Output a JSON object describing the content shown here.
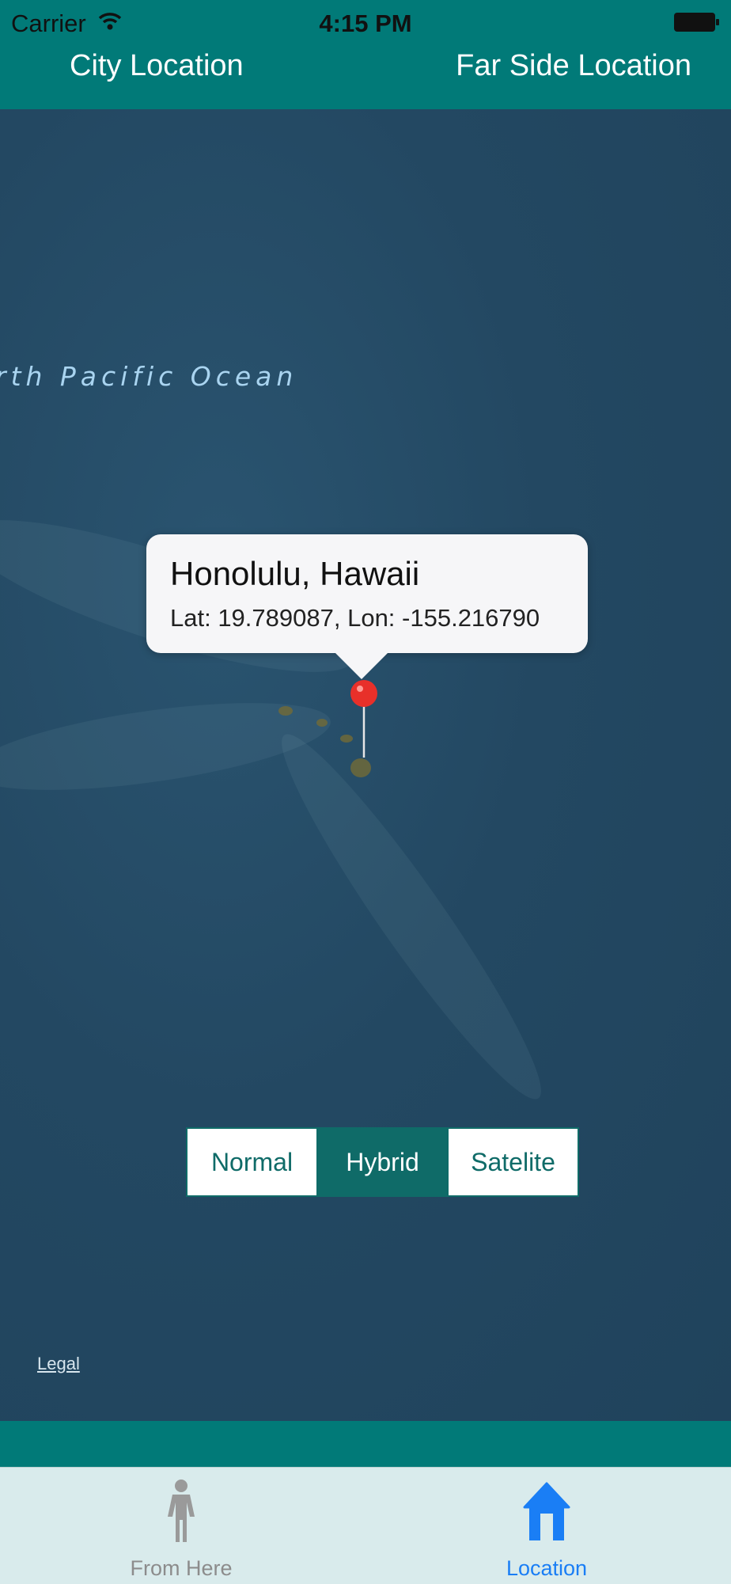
{
  "status_bar": {
    "carrier": "Carrier",
    "time": "4:15 PM"
  },
  "nav": {
    "left_button": "City Location",
    "right_button": "Far Side Location"
  },
  "map": {
    "ocean_label": "rth Pacific Ocean",
    "callout": {
      "title": "Honolulu, Hawaii",
      "subtitle": "Lat: 19.789087, Lon: -155.216790"
    },
    "legal": "Legal",
    "segments": [
      {
        "label": "Normal",
        "selected": false
      },
      {
        "label": "Hybrid",
        "selected": true
      },
      {
        "label": "Satelite",
        "selected": false
      }
    ],
    "pin_color": "#e8302a"
  },
  "tabs": [
    {
      "label": "From Here",
      "icon": "person-icon",
      "selected": false
    },
    {
      "label": "Location",
      "icon": "home-icon",
      "selected": true
    }
  ],
  "colors": {
    "bar": "#017a78",
    "accent": "#0f6b68",
    "tab_active": "#1a7ef5",
    "tab_inactive": "#8c8c8c"
  }
}
